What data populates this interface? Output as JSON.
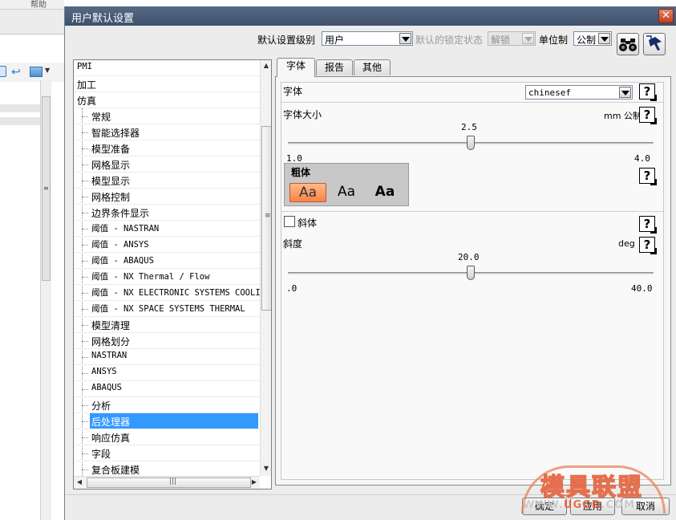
{
  "background_app": {
    "menu_item": "帮助"
  },
  "dialog": {
    "title": "用户默认设置",
    "close_glyph": "✕"
  },
  "topbar": {
    "level_label": "默认设置级别",
    "level_value": "用户",
    "lock_label": "默认的锁定状态",
    "lock_value": "解锁",
    "units_label": "单位制",
    "units_value": "公制",
    "find_icon": "binoculars-icon",
    "help_icon": "cursor-help-icon"
  },
  "tree": {
    "items": [
      {
        "label": "PMI",
        "level": 0
      },
      {
        "label": "加工",
        "level": 0
      },
      {
        "label": "仿真",
        "level": 0
      },
      {
        "label": "常规",
        "level": 1
      },
      {
        "label": "智能选择器",
        "level": 1
      },
      {
        "label": "模型准备",
        "level": 1
      },
      {
        "label": "网格显示",
        "level": 1
      },
      {
        "label": "模型显示",
        "level": 1
      },
      {
        "label": "网格控制",
        "level": 1
      },
      {
        "label": "边界条件显示",
        "level": 1
      },
      {
        "label": "阈值 - NASTRAN",
        "level": 1
      },
      {
        "label": "阈值 - ANSYS",
        "level": 1
      },
      {
        "label": "阈值 - ABAQUS",
        "level": 1
      },
      {
        "label": "阈值 - NX Thermal / Flow",
        "level": 1
      },
      {
        "label": "阈值 - NX ELECTRONIC SYSTEMS COOLING",
        "level": 1
      },
      {
        "label": "阈值 - NX SPACE SYSTEMS THERMAL",
        "level": 1
      },
      {
        "label": "模型清理",
        "level": 1
      },
      {
        "label": "网格划分",
        "level": 1
      },
      {
        "label": "NASTRAN",
        "level": 1
      },
      {
        "label": "ANSYS",
        "level": 1
      },
      {
        "label": "ABAQUS",
        "level": 1
      },
      {
        "label": "分析",
        "level": 1
      },
      {
        "label": "后处理器",
        "level": 1,
        "selected": true
      },
      {
        "label": "响应仿真",
        "level": 1
      },
      {
        "label": "字段",
        "level": 1
      },
      {
        "label": "复合板建模",
        "level": 1
      }
    ],
    "hscroll_grip": "|||",
    "vscroll_grip": "≡"
  },
  "tabs": [
    {
      "label": "字体",
      "active": true
    },
    {
      "label": "报告",
      "active": false
    },
    {
      "label": "其他",
      "active": false
    }
  ],
  "font_tab": {
    "font_label": "字体",
    "font_value": "chinesef",
    "font_size_label": "字体大小",
    "font_size_unit": "mm 公制",
    "font_size_value": "2.5",
    "font_size_min": "1.0",
    "font_size_max": "4.0",
    "font_size_fraction": 0.5,
    "bold_label": "粗体",
    "bold_options": [
      "Aa",
      "Aa",
      "Aa"
    ],
    "italic_label": "斜体",
    "italic_checked": false,
    "slant_label": "斜度",
    "slant_unit": "deg",
    "slant_value": "20.0",
    "slant_min": ".0",
    "slant_max": "40.0",
    "slant_fraction": 0.5,
    "help_glyph": "?"
  },
  "buttons": {
    "ok": "确定",
    "apply": "应用",
    "cancel": "取消"
  },
  "watermark": {
    "title": "模具联盟",
    "url_a": "WWW.",
    "url_b": "UGGD",
    "url_c": ".COM"
  }
}
